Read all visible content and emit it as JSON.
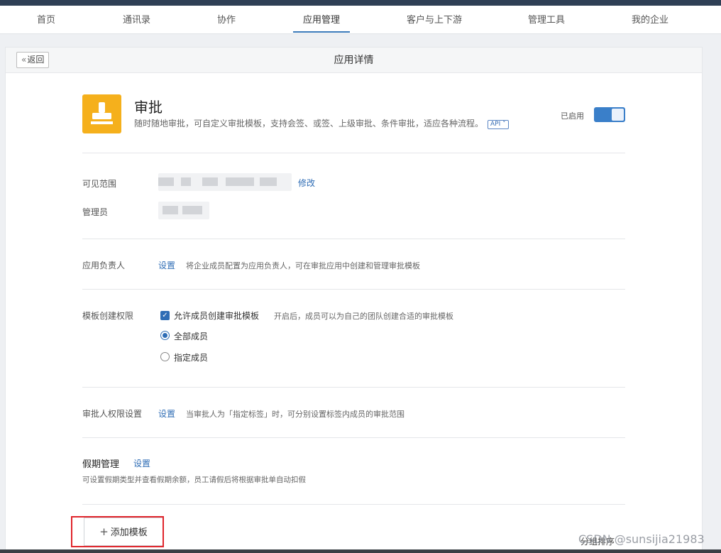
{
  "nav": {
    "items": [
      {
        "label": "首页"
      },
      {
        "label": "通讯录"
      },
      {
        "label": "协作"
      },
      {
        "label": "应用管理",
        "active": true
      },
      {
        "label": "客户与上下游"
      },
      {
        "label": "管理工具"
      },
      {
        "label": "我的企业"
      }
    ]
  },
  "header": {
    "back_label": "返回",
    "title": "应用详情"
  },
  "app": {
    "name": "审批",
    "description": "随时随地审批，可自定义审批模板，支持会签、或签、上级审批、条件审批，适应各种流程。",
    "api_tag": "API",
    "status_label": "已启用",
    "enabled": true,
    "icon": "stamp-icon",
    "icon_color": "#f5b01c"
  },
  "visibility": {
    "label": "可见范围",
    "action": "修改"
  },
  "admin": {
    "label": "管理员"
  },
  "owner": {
    "label": "应用负责人",
    "action": "设置",
    "hint": "将企业成员配置为应用负责人，可在审批应用中创建和管理审批模板"
  },
  "template_perm": {
    "label": "模板创建权限",
    "checkbox_label": "允许成员创建审批模板",
    "checkbox_checked": true,
    "checkbox_hint": "开启后，成员可以为自己的团队创建合适的审批模板",
    "options": [
      {
        "label": "全部成员",
        "selected": true
      },
      {
        "label": "指定成员",
        "selected": false
      }
    ]
  },
  "approver_perm": {
    "label": "审批人权限设置",
    "action": "设置",
    "hint": "当审批人为「指定标签」时，可分别设置标签内成员的审批范围"
  },
  "leave": {
    "title": "假期管理",
    "action": "设置",
    "hint": "可设置假期类型并查看假期余额，员工请假后将根据审批单自动扣假"
  },
  "add_template": {
    "label": "添加模板"
  },
  "overlay": {
    "ghost_text": "分组排序",
    "watermark": "CSDN @sunsijia21983"
  },
  "colors": {
    "accent": "#2f6db5",
    "highlight_border": "#e0252b"
  }
}
